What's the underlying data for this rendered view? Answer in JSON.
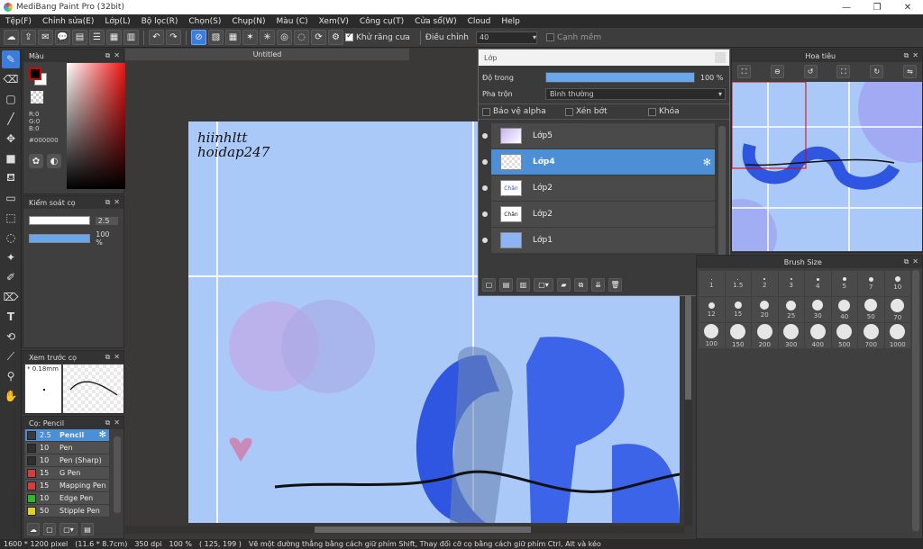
{
  "window": {
    "title": "MediBang Paint Pro (32bit)",
    "controls": [
      "—",
      "❐",
      "✕"
    ]
  },
  "menu": [
    "Tệp(F)",
    "Chỉnh sửa(E)",
    "Lớp(L)",
    "Bộ lọc(R)",
    "Chọn(S)",
    "Chụp(N)",
    "Màu (C)",
    "Xem(V)",
    "Công cụ(T)",
    "Cửa sổ(W)",
    "Cloud",
    "Help"
  ],
  "toolbar": {
    "antialias_label": "Khử răng cưa",
    "adjust_label": "Điều chỉnh",
    "adjust_value": "40",
    "edge_label": "Cạnh mềm"
  },
  "color_panel": {
    "title": "Màu",
    "r": "R:0",
    "g": "G:0",
    "b": "B:0",
    "hex": "#000000",
    "primary": "#000000",
    "secondary": "#ffffff"
  },
  "brush_control": {
    "title": "Kiểm soát cọ",
    "size_value": "2.5",
    "opacity_value": "100 %"
  },
  "brush_preview": {
    "title": "Xem trước cọ",
    "size": "* 0.18mm"
  },
  "brush_list": {
    "title": "Cọ: Pencil",
    "items": [
      {
        "size": "2.5",
        "name": "Pencil",
        "color": "#3a3a3a"
      },
      {
        "size": "10",
        "name": "Pen",
        "color": "#2e2e2e"
      },
      {
        "size": "10",
        "name": "Pen (Sharp)",
        "color": "#2e2e2e"
      },
      {
        "size": "15",
        "name": "G Pen",
        "color": "#d83b3b"
      },
      {
        "size": "15",
        "name": "Mapping Pen",
        "color": "#d83b3b"
      },
      {
        "size": "10",
        "name": "Edge Pen",
        "color": "#32b432"
      },
      {
        "size": "50",
        "name": "Stipple Pen",
        "color": "#e0d030"
      }
    ]
  },
  "canvas": {
    "tab_title": "Untitled",
    "handwriting_line1": "hiinhltt",
    "handwriting_line2": "hoidap247"
  },
  "layer_panel": {
    "title": "Lớp",
    "opacity_label": "Độ trong",
    "opacity_value": "100 %",
    "opacity_fraction": 1.0,
    "blend_label": "Pha trộn",
    "blend_value": "Bình thường",
    "protect_alpha": "Bảo vệ alpha",
    "clipping": "Xén bớt",
    "lock": "Khóa",
    "layers": [
      {
        "name": "Lớp5",
        "thumb": "",
        "selected": false
      },
      {
        "name": "Lớp4",
        "thumb": "",
        "selected": true
      },
      {
        "name": "Lớp2",
        "thumb": "Chân",
        "selected": false
      },
      {
        "name": "Lớp2",
        "thumb": "Chân",
        "selected": false
      },
      {
        "name": "Lớp1",
        "thumb": "",
        "selected": false
      }
    ]
  },
  "navigator": {
    "title": "Hoa tiêu"
  },
  "brush_size": {
    "title": "Brush Size",
    "sizes": [
      "1",
      "1.5",
      "2",
      "3",
      "4",
      "5",
      "7",
      "10",
      "12",
      "15",
      "20",
      "25",
      "30",
      "40",
      "50",
      "70",
      "100",
      "150",
      "200",
      "300",
      "400",
      "500",
      "700",
      "1000"
    ]
  },
  "status": {
    "dimensions": "1600 * 1200 pixel",
    "physical": "(11.6 * 8.7cm)",
    "dpi": "350 dpi",
    "zoom": "100 %",
    "coords": "( 125, 199 )",
    "hint": "Vẽ một đường thẳng bằng cách giữ phím Shift, Thay đổi cỡ cọ bằng cách giữ phím Ctrl, Alt và kéo"
  },
  "colors": {
    "accent": "#4d8fd6",
    "canvas_bg": "#aac8f8"
  }
}
